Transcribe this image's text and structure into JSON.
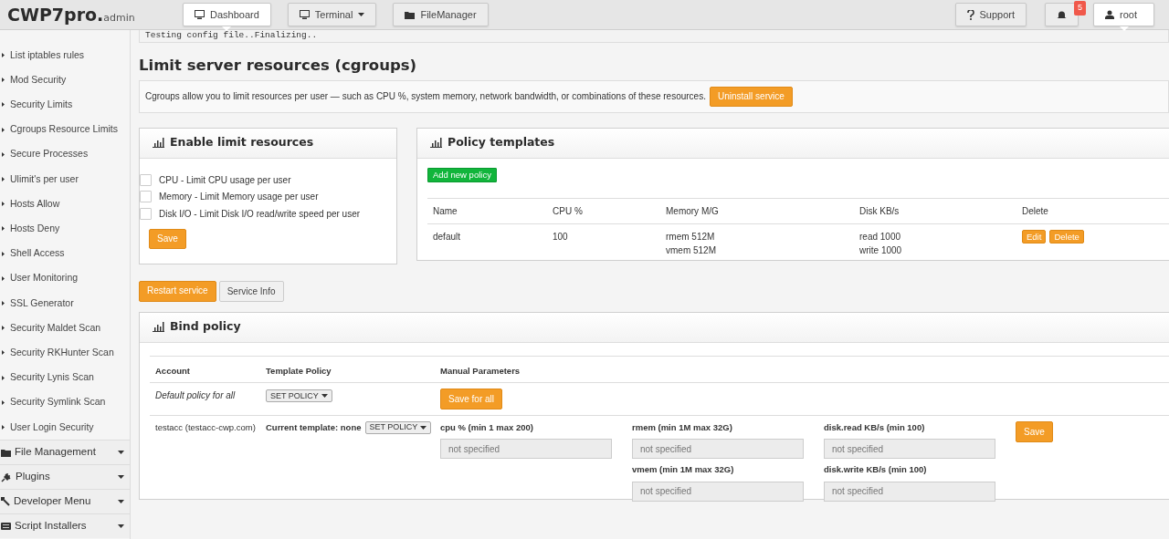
{
  "header": {
    "logo": {
      "main": "CWP7pro.",
      "sub": "admin"
    },
    "nav": [
      {
        "label": "Dashboard",
        "kind": "monitor",
        "dropdown": false,
        "selected": true
      },
      {
        "label": "Terminal",
        "kind": "monitor",
        "dropdown": true,
        "selected": false
      },
      {
        "label": "FileManager",
        "kind": "folder",
        "dropdown": false,
        "selected": false
      }
    ],
    "support": {
      "label": "Support"
    },
    "notifications": {
      "count": "5"
    },
    "user": {
      "label": "root"
    }
  },
  "sidebar": {
    "items": [
      "List iptables rules",
      "Mod Security",
      "Security Limits",
      "Cgroups Resource Limits",
      "Secure Processes",
      "Ulimit's per user",
      "Hosts Allow",
      "Hosts Deny",
      "Shell Access",
      "User Monitoring",
      "SSL Generator",
      "Security Maldet Scan",
      "Security RKHunter Scan",
      "Security Lynis Scan",
      "Security Symlink Scan",
      "User Login Security"
    ],
    "sections": [
      {
        "label": "File Management",
        "kind": "folder"
      },
      {
        "label": "Plugins",
        "kind": "plug"
      },
      {
        "label": "Developer Menu",
        "kind": "wrench"
      },
      {
        "label": "Script Installers",
        "kind": "keyboard"
      }
    ]
  },
  "console_output": "Testing config file..Finalizing..",
  "page_title": "Limit server resources (cgroups)",
  "intro": {
    "text": "Cgroups allow you to limit resources per user — such as CPU %, system memory, network bandwidth, or combinations of these resources.",
    "button": "Uninstall service"
  },
  "enable_card": {
    "title": "Enable limit resources",
    "options": [
      {
        "label": "CPU - Limit CPU usage per user",
        "checked": false
      },
      {
        "label": "Memory - Limit Memory usage per user",
        "checked": false
      },
      {
        "label": "Disk I/O - Limit Disk I/O read/write speed per user",
        "checked": false
      }
    ],
    "save": "Save"
  },
  "policy_card": {
    "title": "Policy templates",
    "add_button": "Add new policy",
    "columns": [
      "Name",
      "CPU %",
      "Memory M/G",
      "Disk KB/s",
      "Delete"
    ],
    "rows": [
      {
        "name": "default",
        "cpu": "100",
        "memory": [
          "rmem 512M",
          "vmem 512M"
        ],
        "disk": [
          "read 1000",
          "write 1000"
        ],
        "actions": [
          "Edit",
          "Delete"
        ]
      }
    ]
  },
  "service_buttons": [
    {
      "label": "Restart service",
      "kind": "primary"
    },
    {
      "label": "Service Info",
      "kind": "secondary"
    }
  ],
  "bind_card": {
    "title": "Bind policy",
    "columns": [
      "Account",
      "Template Policy",
      "Manual Parameters"
    ],
    "default_row": {
      "account": "Default policy for all",
      "select": "SET POLICY",
      "button": "Save for all"
    },
    "users": [
      {
        "account": "testacc (testacc-cwp.com)",
        "current_template": "Current template: none",
        "select": "SET POLICY",
        "param_groups": [
          [
            {
              "label": "cpu % (min 1 max 200)",
              "placeholder": "not specified"
            }
          ],
          [
            {
              "label": "rmem (min 1M max 32G)",
              "placeholder": "not specified"
            },
            {
              "label": "vmem (min 1M max 32G)",
              "placeholder": "not specified"
            }
          ],
          [
            {
              "label": "disk.read KB/s (min 100)",
              "placeholder": "not specified"
            },
            {
              "label": "disk.write KB/s (min 100)",
              "placeholder": "not specified"
            }
          ]
        ],
        "save": "Save"
      }
    ]
  }
}
